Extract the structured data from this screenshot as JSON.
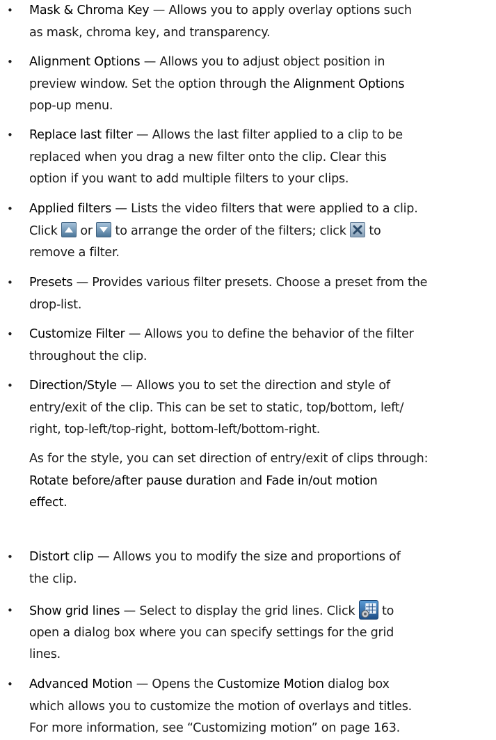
{
  "items": [
    {
      "lines": [
        [
          {
            "b": "Mask & Chroma Key"
          },
          {
            "t": " — Allows you to apply overlay options such"
          }
        ],
        [
          {
            "t": "as mask, chroma key, and transparency."
          }
        ]
      ]
    },
    {
      "lines": [
        [
          {
            "b": "Alignment Options"
          },
          {
            "t": " — Allows you to adjust object position in"
          }
        ],
        [
          {
            "t": "preview window. Set the option through the "
          },
          {
            "b": "Alignment Options"
          }
        ],
        [
          {
            "t": "pop-up menu."
          }
        ]
      ]
    },
    {
      "lines": [
        [
          {
            "b": "Replace last filter"
          },
          {
            "t": " — Allows the last filter applied to a clip to be"
          }
        ],
        [
          {
            "t": "replaced when you drag a new filter onto the clip. Clear this"
          }
        ],
        [
          {
            "t": "option if you want to add multiple filters to your clips."
          }
        ]
      ]
    },
    {
      "lines": [
        [
          {
            "b": "Applied filters"
          },
          {
            "t": " — Lists the video filters that were applied to a clip."
          }
        ],
        [
          {
            "t": "Click "
          },
          {
            "icon": "arrow-up-icon"
          },
          {
            "t": " or "
          },
          {
            "icon": "arrow-down-icon"
          },
          {
            "t": " to arrange the order of the filters; click "
          },
          {
            "icon": "close-icon"
          },
          {
            "t": " to"
          }
        ],
        [
          {
            "t": "remove a filter."
          }
        ]
      ]
    },
    {
      "lines": [
        [
          {
            "b": "Presets"
          },
          {
            "t": " — Provides various filter presets. Choose a preset from the"
          }
        ],
        [
          {
            "t": "drop-list."
          }
        ]
      ]
    },
    {
      "lines": [
        [
          {
            "b": "Customize Filter"
          },
          {
            "t": " — Allows you to define the behavior of the filter"
          }
        ],
        [
          {
            "t": "throughout the clip."
          }
        ]
      ]
    },
    {
      "lines": [
        [
          {
            "b": "Direction/Style"
          },
          {
            "t": " — Allows you to set the direction and style of"
          }
        ],
        [
          {
            "t": "entry/exit of the clip. This can be set to static, top/bottom, left/"
          }
        ],
        [
          {
            "t": "right, top-left/top-right, bottom-left/bottom-right."
          }
        ]
      ],
      "extra": [
        [
          {
            "t": "As for the style, you can set direction of entry/exit of clips through:"
          }
        ],
        [
          {
            "b": "Rotate before/after pause duration"
          },
          {
            "t": " and "
          },
          {
            "b": "Fade in/out motion"
          }
        ],
        [
          {
            "b": "effect"
          },
          {
            "t": "."
          }
        ]
      ]
    },
    {
      "lines": [
        [
          {
            "b": "Distort clip"
          },
          {
            "t": " — Allows you to modify the size and proportions of"
          }
        ],
        [
          {
            "t": "the clip."
          }
        ]
      ]
    },
    {
      "lines": [
        [
          {
            "b": "Show grid lines"
          },
          {
            "t": " — Select to display the grid lines. Click "
          },
          {
            "icon": "grid-settings-icon"
          },
          {
            "t": " to"
          }
        ],
        [
          {
            "t": "open a dialog box where you can specify settings for the grid"
          }
        ],
        [
          {
            "t": "lines."
          }
        ]
      ]
    },
    {
      "lines": [
        [
          {
            "b": "Advanced Motion"
          },
          {
            "t": " — Opens the "
          },
          {
            "b": "Customize Motion"
          },
          {
            "t": " dialog box"
          }
        ],
        [
          {
            "t": "which allows you to customize the motion of overlays and titles."
          }
        ],
        [
          {
            "t": "For more information, see “Customizing motion” on page 163."
          }
        ]
      ]
    }
  ]
}
